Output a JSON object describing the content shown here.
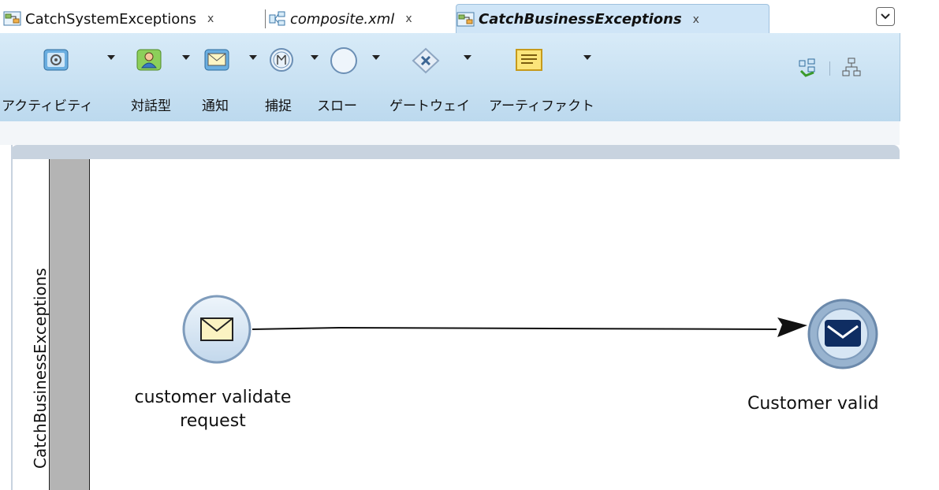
{
  "tabs": [
    {
      "label": "CatchSystemExceptions",
      "close": "x",
      "icon": "bpmn-process-icon"
    },
    {
      "label": "composite.xml",
      "close": "x",
      "icon": "composite-icon"
    },
    {
      "label": "CatchBusinessExceptions",
      "close": "x",
      "icon": "bpmn-process-icon",
      "active": true
    }
  ],
  "palette": {
    "items": [
      {
        "label": "アクティビティ",
        "icon": "activity-icon",
        "has_dropdown": true
      },
      {
        "label": "対話型",
        "icon": "human-task-icon",
        "has_dropdown": true
      },
      {
        "label": "通知",
        "icon": "notification-icon",
        "has_dropdown": true
      },
      {
        "label": "捕捉",
        "icon": "catch-event-icon",
        "has_dropdown": true
      },
      {
        "label": "スロー",
        "icon": "throw-event-icon",
        "has_dropdown": true
      },
      {
        "label": "ゲートウェイ",
        "icon": "gateway-icon",
        "has_dropdown": true
      },
      {
        "label": "アーティファクト",
        "icon": "artifact-icon",
        "has_dropdown": true
      }
    ]
  },
  "lane": {
    "title": "CatchBusinessExceptions"
  },
  "nodes": {
    "start": {
      "label_line1": "customer validate",
      "label_line2": "request",
      "icon": "message-start-event-icon"
    },
    "end": {
      "label": "Customer valid",
      "icon": "message-end-event-icon"
    }
  },
  "colors": {
    "palette_bg": "#c9e2f4",
    "active_tab": "#cfe5f7",
    "lane_bar": "#b4b4b4",
    "event_fill": "#d7e6f4",
    "end_event_ring": "#7f9cbc",
    "envelope_yellow": "#fbf3c2",
    "envelope_navy": "#0f2d62"
  }
}
